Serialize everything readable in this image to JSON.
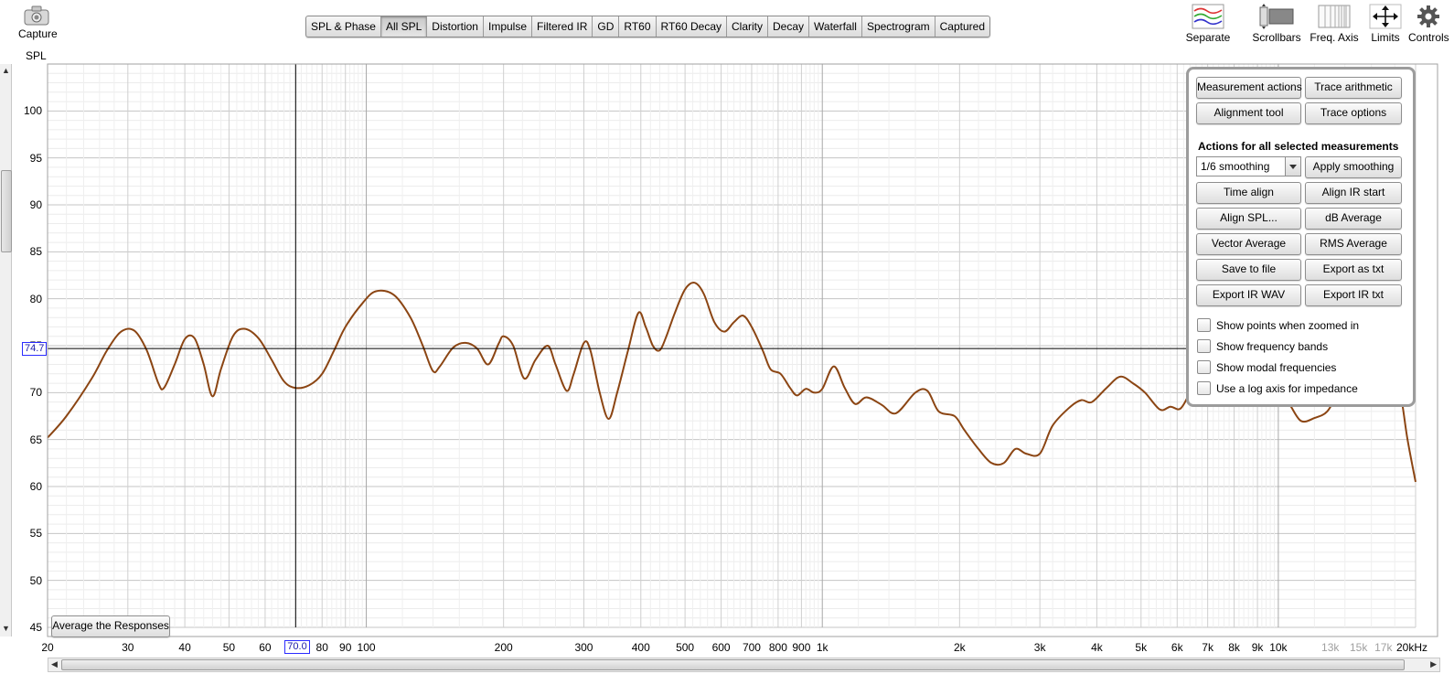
{
  "toolbar": {
    "capture": {
      "label": "Capture"
    },
    "separate": {
      "label": "Separate"
    },
    "scrollbars": {
      "label": "Scrollbars"
    },
    "freq_axis": {
      "label": "Freq. Axis"
    },
    "limits": {
      "label": "Limits"
    },
    "controls": {
      "label": "Controls"
    }
  },
  "tabs": [
    {
      "label": "SPL & Phase",
      "active": false
    },
    {
      "label": "All SPL",
      "active": true
    },
    {
      "label": "Distortion",
      "active": false
    },
    {
      "label": "Impulse",
      "active": false
    },
    {
      "label": "Filtered IR",
      "active": false
    },
    {
      "label": "GD",
      "active": false
    },
    {
      "label": "RT60",
      "active": false
    },
    {
      "label": "RT60 Decay",
      "active": false
    },
    {
      "label": "Clarity",
      "active": false
    },
    {
      "label": "Decay",
      "active": false
    },
    {
      "label": "Waterfall",
      "active": false
    },
    {
      "label": "Spectrogram",
      "active": false
    },
    {
      "label": "Captured",
      "active": false
    }
  ],
  "graph": {
    "y_axis_label": "SPL",
    "y_ticks": [
      "100",
      "95",
      "90",
      "85",
      "80",
      "75",
      "70",
      "65",
      "60",
      "55",
      "50",
      "45"
    ],
    "x_ticks": [
      {
        "f": 20,
        "label": "20"
      },
      {
        "f": 30,
        "label": "30"
      },
      {
        "f": 40,
        "label": "40"
      },
      {
        "f": 50,
        "label": "50"
      },
      {
        "f": 60,
        "label": "60"
      },
      {
        "f": 80,
        "label": "80"
      },
      {
        "f": 90,
        "label": "90"
      },
      {
        "f": 100,
        "label": "100"
      },
      {
        "f": 200,
        "label": "200"
      },
      {
        "f": 300,
        "label": "300"
      },
      {
        "f": 400,
        "label": "400"
      },
      {
        "f": 500,
        "label": "500"
      },
      {
        "f": 600,
        "label": "600"
      },
      {
        "f": 700,
        "label": "700"
      },
      {
        "f": 800,
        "label": "800"
      },
      {
        "f": 900,
        "label": "900"
      },
      {
        "f": 1000,
        "label": "1k"
      },
      {
        "f": 2000,
        "label": "2k"
      },
      {
        "f": 3000,
        "label": "3k"
      },
      {
        "f": 4000,
        "label": "4k"
      },
      {
        "f": 5000,
        "label": "5k"
      },
      {
        "f": 6000,
        "label": "6k"
      },
      {
        "f": 7000,
        "label": "7k"
      },
      {
        "f": 8000,
        "label": "8k"
      },
      {
        "f": 9000,
        "label": "9k"
      },
      {
        "f": 10000,
        "label": "10k"
      },
      {
        "f": 13000,
        "label": "13k",
        "grey": true
      },
      {
        "f": 15000,
        "label": "15k",
        "grey": true
      },
      {
        "f": 17000,
        "label": "17k",
        "grey": true
      },
      {
        "f": 20000,
        "label": "20kHz"
      }
    ],
    "cursor_x_label": "70.0",
    "cursor_y_label": "74.7",
    "cursor_freq": 70,
    "cursor_db": 74.7,
    "trace_color": "#8B4513",
    "trace": [
      [
        20,
        65.2
      ],
      [
        22,
        67.5
      ],
      [
        25,
        71.5
      ],
      [
        27,
        74.5
      ],
      [
        29,
        76.5
      ],
      [
        31,
        76.6
      ],
      [
        33,
        74.5
      ],
      [
        35,
        71
      ],
      [
        36,
        70.5
      ],
      [
        38,
        73
      ],
      [
        40,
        75.7
      ],
      [
        42,
        75.8
      ],
      [
        44,
        73
      ],
      [
        46,
        69.6
      ],
      [
        48,
        72.5
      ],
      [
        51,
        76
      ],
      [
        54,
        76.8
      ],
      [
        58,
        75.8
      ],
      [
        62,
        73.5
      ],
      [
        66,
        71.2
      ],
      [
        70,
        70.5
      ],
      [
        75,
        70.8
      ],
      [
        80,
        72
      ],
      [
        85,
        74.5
      ],
      [
        90,
        77
      ],
      [
        98,
        79.5
      ],
      [
        105,
        80.8
      ],
      [
        115,
        80.4
      ],
      [
        125,
        78
      ],
      [
        133,
        75
      ],
      [
        140,
        72.3
      ],
      [
        145,
        72.8
      ],
      [
        155,
        74.8
      ],
      [
        165,
        75.3
      ],
      [
        175,
        74.7
      ],
      [
        185,
        73
      ],
      [
        195,
        75.2
      ],
      [
        200,
        76
      ],
      [
        210,
        75
      ],
      [
        222,
        71.5
      ],
      [
        235,
        73.5
      ],
      [
        250,
        75
      ],
      [
        260,
        73
      ],
      [
        275,
        70.2
      ],
      [
        285,
        72
      ],
      [
        300,
        75.3
      ],
      [
        310,
        74.5
      ],
      [
        325,
        70
      ],
      [
        340,
        67.2
      ],
      [
        355,
        70
      ],
      [
        375,
        74.5
      ],
      [
        395,
        78.5
      ],
      [
        410,
        77
      ],
      [
        425,
        75
      ],
      [
        440,
        74.5
      ],
      [
        455,
        76
      ],
      [
        475,
        78.5
      ],
      [
        500,
        81
      ],
      [
        525,
        81.7
      ],
      [
        550,
        80.5
      ],
      [
        580,
        77.5
      ],
      [
        610,
        76.5
      ],
      [
        640,
        77.5
      ],
      [
        670,
        78.2
      ],
      [
        700,
        77
      ],
      [
        740,
        74.5
      ],
      [
        770,
        72.5
      ],
      [
        810,
        72
      ],
      [
        850,
        70.5
      ],
      [
        880,
        69.7
      ],
      [
        920,
        70.4
      ],
      [
        960,
        70
      ],
      [
        1000,
        70.4
      ],
      [
        1060,
        72.8
      ],
      [
        1120,
        70.5
      ],
      [
        1180,
        68.8
      ],
      [
        1250,
        69.5
      ],
      [
        1350,
        68.7
      ],
      [
        1450,
        67.8
      ],
      [
        1600,
        70
      ],
      [
        1700,
        70.2
      ],
      [
        1800,
        68
      ],
      [
        1950,
        67.5
      ],
      [
        2050,
        66
      ],
      [
        2200,
        64
      ],
      [
        2350,
        62.5
      ],
      [
        2500,
        62.5
      ],
      [
        2650,
        64
      ],
      [
        2800,
        63.5
      ],
      [
        3000,
        63.5
      ],
      [
        3200,
        66.5
      ],
      [
        3500,
        68.5
      ],
      [
        3700,
        69.2
      ],
      [
        3900,
        69
      ],
      [
        4200,
        70.5
      ],
      [
        4500,
        71.7
      ],
      [
        4800,
        71
      ],
      [
        5100,
        70
      ],
      [
        5500,
        68.2
      ],
      [
        5800,
        68.5
      ],
      [
        6100,
        68.3
      ],
      [
        6400,
        70
      ],
      [
        6800,
        72.5
      ],
      [
        7200,
        73.8
      ],
      [
        7700,
        74
      ],
      [
        8200,
        72.5
      ],
      [
        9000,
        71.5
      ],
      [
        9800,
        70.5
      ],
      [
        10500,
        69
      ],
      [
        11200,
        67
      ],
      [
        12000,
        67.3
      ],
      [
        12800,
        68
      ],
      [
        13500,
        70
      ],
      [
        14500,
        73
      ],
      [
        15500,
        75
      ],
      [
        16500,
        75.5
      ],
      [
        17500,
        73.5
      ],
      [
        18500,
        70
      ],
      [
        19200,
        65
      ],
      [
        20000,
        60.5
      ]
    ]
  },
  "average_button": "Average the Responses",
  "panel": {
    "measurement_actions": "Measurement actions",
    "trace_arithmetic": "Trace arithmetic",
    "alignment_tool": "Alignment tool",
    "trace_options": "Trace options",
    "section_title": "Actions for all selected measurements",
    "smoothing_value": "1/6 smoothing",
    "apply_smoothing": "Apply smoothing",
    "time_align": "Time align",
    "align_ir_start": "Align IR start",
    "align_spl": "Align SPL...",
    "db_average": "dB Average",
    "vector_average": "Vector Average",
    "rms_average": "RMS Average",
    "save_to_file": "Save to file",
    "export_as_txt": "Export as txt",
    "export_ir_wav": "Export IR WAV",
    "export_ir_txt": "Export IR txt",
    "checkboxes": [
      {
        "label": "Show points when zoomed in",
        "checked": false
      },
      {
        "label": "Show frequency bands",
        "checked": false
      },
      {
        "label": "Show modal frequencies",
        "checked": false
      },
      {
        "label": "Use a log axis for impedance",
        "checked": false
      }
    ]
  }
}
